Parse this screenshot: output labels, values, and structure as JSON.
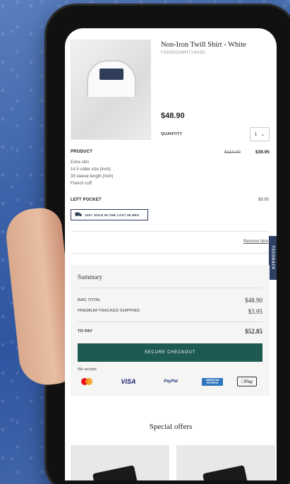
{
  "product": {
    "name": "Non-Iron Twill Shirt - White",
    "sku": "FON0033WHT14H3D",
    "price": "$48.90",
    "quantity_label": "QUANTITY",
    "quantity_value": "1"
  },
  "details": {
    "section_label": "PRODUCT",
    "old_price": "$110.00",
    "new_price": "$39.95",
    "lines": [
      "Extra slim",
      "14.5 collar size (inch)",
      "33 sleeve length (inch)",
      "French cuff"
    ]
  },
  "pocket": {
    "label": "LEFT POCKET",
    "price": "$8.95",
    "badge": "100+ SOLD IN THE LAST 48 HRS"
  },
  "remove_label": "Remove item",
  "feedback_label": "FEEDBACK",
  "summary": {
    "title": "Summary",
    "bag_total_label": "BAG TOTAL",
    "bag_total_value": "$48.90",
    "shipping_label": "PREMIUM TRACKED SHIPPING",
    "shipping_value": "$3.95",
    "to_pay_label": "TO PAY",
    "to_pay_value": "$52.85",
    "checkout_label": "SECURE CHECKOUT",
    "we_accept": "We accept:",
    "payments": {
      "visa": "VISA",
      "paypal": "PayPal",
      "amex": "AMERICAN EXPRESS",
      "applepay": "Pay"
    }
  },
  "offers_title": "Special offers",
  "colors": {
    "checkout": "#1d5a52",
    "feedback": "#2d3f63",
    "badge_border": "#2b3a55"
  }
}
